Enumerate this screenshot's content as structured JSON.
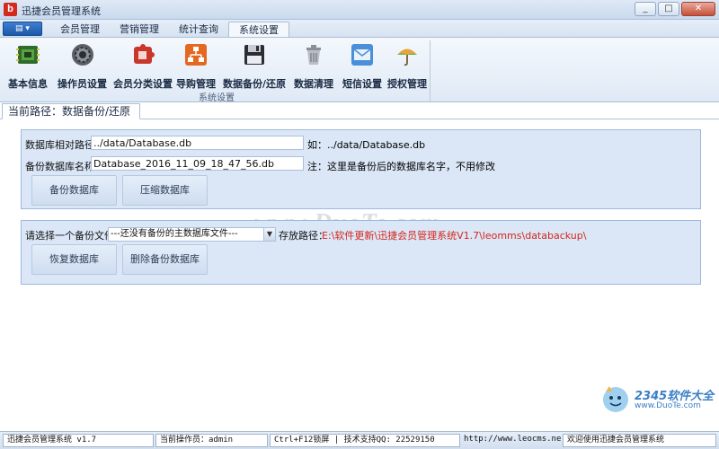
{
  "window": {
    "title": "迅捷会员管理系统",
    "app_icon_letter": "b",
    "minimize": "_",
    "maximize": "□",
    "close": "✕"
  },
  "app_menu_button": "▤ ▾",
  "tabs": [
    {
      "label": "会员管理",
      "active": false
    },
    {
      "label": "营销管理",
      "active": false
    },
    {
      "label": "统计查询",
      "active": false
    },
    {
      "label": "系统设置",
      "active": true
    }
  ],
  "ribbon": {
    "group_label": "系统设置",
    "items": [
      {
        "label": "基本信息",
        "icon": "circuit-board-icon"
      },
      {
        "label": "操作员设置",
        "icon": "gear-icon"
      },
      {
        "label": "会员分类设置",
        "icon": "puzzle-icon"
      },
      {
        "label": "导购管理",
        "icon": "org-chart-icon"
      },
      {
        "label": "数据备份/还原",
        "icon": "floppy-disk-icon"
      },
      {
        "label": "数据清理",
        "icon": "trash-can-icon"
      },
      {
        "label": "短信设置",
        "icon": "envelope-icon"
      },
      {
        "label": "授权管理",
        "icon": "umbrella-icon"
      }
    ]
  },
  "breadcrumb": "当前路径：数据备份/还原",
  "backup_panel": {
    "db_path_label": "数据库相对路径：",
    "db_path_value": "../data/Database.db",
    "db_path_example": "如：../data/Database.db",
    "backup_name_label": "备份数据库名称：",
    "backup_name_value": "Database_2016_11_09_18_47_56.db",
    "backup_name_note": "注：这里是备份后的数据库名字，不用修改",
    "backup_button": "备份数据库",
    "compress_button": "压缩数据库"
  },
  "restore_panel": {
    "select_label": "请选择一个备份文件：",
    "select_value": "---还没有备份的主数据库文件---",
    "storage_label": "存放路径：",
    "storage_path": "E:\\软件更新\\迅捷会员管理系统V1.7\\leomms\\databackup\\",
    "restore_button": "恢复数据库",
    "delete_button": "删除备份数据库"
  },
  "watermark": {
    "text": "www.DuoTe.com",
    "logo_main": "2345软件大全",
    "logo_sub": "www.DuoTe.com"
  },
  "statusbar": {
    "system": "迅捷会员管理系统 v1.7",
    "operator": "当前操作员：admin",
    "shortcut": "Ctrl+F12锁屏 | 技术支持QQ: 22529150",
    "website": "http://www.leocms.net",
    "welcome": "欢迎使用迅捷会员管理系统"
  },
  "colors": {
    "accent_blue": "#1c58a8",
    "panel_bg": "#dbe7f7",
    "warning_red": "#d4261a"
  }
}
